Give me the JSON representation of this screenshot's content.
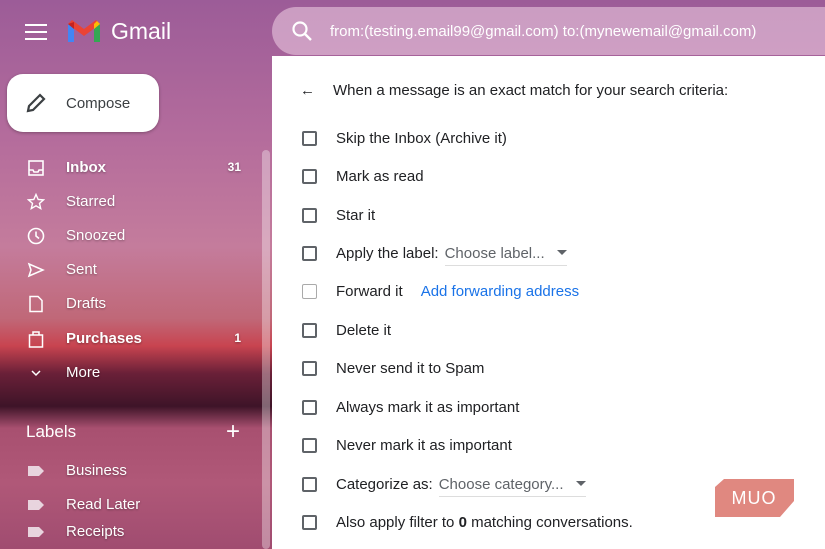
{
  "app": {
    "name": "Gmail"
  },
  "search": {
    "query": "from:(testing.email99@gmail.com) to:(mynewemail@gmail.com)"
  },
  "compose": {
    "label": "Compose"
  },
  "nav": [
    {
      "label": "Inbox",
      "count": "31",
      "icon": "inbox-icon",
      "bold": true
    },
    {
      "label": "Starred",
      "icon": "star-icon"
    },
    {
      "label": "Snoozed",
      "icon": "clock-icon"
    },
    {
      "label": "Sent",
      "icon": "send-icon"
    },
    {
      "label": "Drafts",
      "icon": "draft-icon"
    },
    {
      "label": "Purchases",
      "count": "1",
      "icon": "bag-icon",
      "bold": true
    },
    {
      "label": "More",
      "icon": "chevron-down-icon"
    }
  ],
  "labels": {
    "title": "Labels",
    "items": [
      "Business",
      "Read Later",
      "Receipts"
    ]
  },
  "filter": {
    "header": "When a message is an exact match for your search criteria:",
    "options": {
      "skip_inbox": "Skip the Inbox (Archive it)",
      "mark_read": "Mark as read",
      "star": "Star it",
      "apply_label": "Apply the label:",
      "label_select": "Choose label...",
      "forward": "Forward it",
      "forward_link": "Add forwarding address",
      "delete": "Delete it",
      "never_spam": "Never send it to Spam",
      "always_important": "Always mark it as important",
      "never_important": "Never mark it as important",
      "categorize": "Categorize as:",
      "category_select": "Choose category...",
      "also_apply_pre": "Also apply filter to ",
      "also_apply_count": "0",
      "also_apply_post": " matching conversations."
    }
  },
  "watermark": "MUO"
}
